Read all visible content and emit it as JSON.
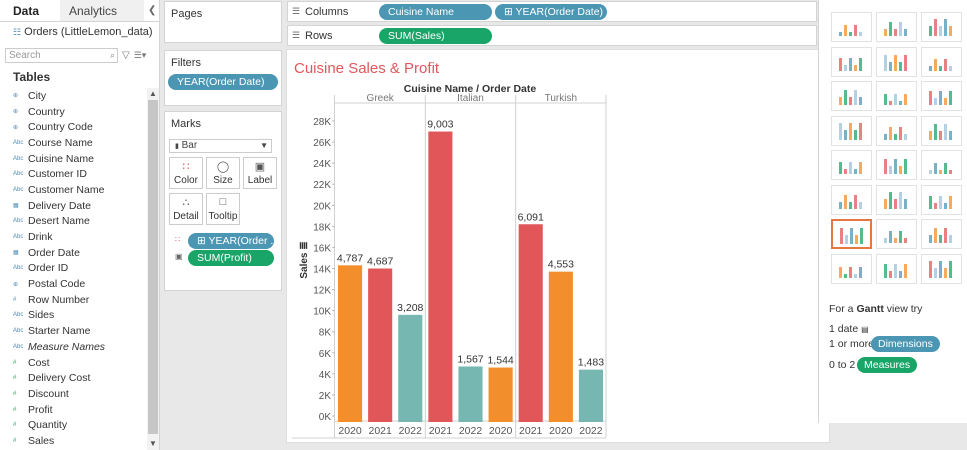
{
  "data_pane": {
    "tabs": [
      "Data",
      "Analytics"
    ],
    "datasource": "Orders (LittleLemon_data)",
    "search_placeholder": "Search",
    "tables_heading": "Tables",
    "fields": [
      {
        "name": "City",
        "kind": "geo"
      },
      {
        "name": "Country",
        "kind": "geo"
      },
      {
        "name": "Country Code",
        "kind": "geo"
      },
      {
        "name": "Course Name",
        "kind": "text"
      },
      {
        "name": "Cuisine Name",
        "kind": "text"
      },
      {
        "name": "Customer ID",
        "kind": "text"
      },
      {
        "name": "Customer Name",
        "kind": "text"
      },
      {
        "name": "Delivery Date",
        "kind": "date"
      },
      {
        "name": "Desert Name",
        "kind": "text"
      },
      {
        "name": "Drink",
        "kind": "text"
      },
      {
        "name": "Order Date",
        "kind": "date"
      },
      {
        "name": "Order ID",
        "kind": "text"
      },
      {
        "name": "Postal Code",
        "kind": "geo"
      },
      {
        "name": "Row Number",
        "kind": "number"
      },
      {
        "name": "Sides",
        "kind": "text"
      },
      {
        "name": "Starter Name",
        "kind": "text"
      },
      {
        "name": "Measure Names",
        "kind": "text",
        "italic": true
      },
      {
        "name": "Cost",
        "kind": "measure"
      },
      {
        "name": "Delivery Cost",
        "kind": "measure"
      },
      {
        "name": "Discount",
        "kind": "measure"
      },
      {
        "name": "Profit",
        "kind": "measure"
      },
      {
        "name": "Quantity",
        "kind": "measure"
      },
      {
        "name": "Sales",
        "kind": "measure"
      }
    ]
  },
  "pages": {
    "title": "Pages"
  },
  "filters": {
    "title": "Filters",
    "pill": "YEAR(Order Date)"
  },
  "marks": {
    "title": "Marks",
    "type": "Bar",
    "buttons": [
      "Color",
      "Size",
      "Label",
      "Detail",
      "Tooltip"
    ],
    "pills": [
      "YEAR(Order ..",
      "SUM(Profit)"
    ]
  },
  "columns": {
    "label": "Columns",
    "pills": [
      "Cuisine Name",
      "YEAR(Order Date)"
    ]
  },
  "rows": {
    "label": "Rows",
    "pills": [
      "SUM(Sales)"
    ]
  },
  "showme": {
    "hint_prefix": "For a ",
    "hint_bold": "Gantt",
    "hint_suffix": " view try",
    "req1": "1 date",
    "req2": "1 or more",
    "req2_pill": "Dimensions",
    "req3": "0 to 2",
    "req3_pill": "Measures",
    "colors": {
      "dimension": "#4b96b3",
      "measure": "#19a468",
      "selected": "#e57743"
    }
  },
  "colors": {
    "year_2020": "#f28e2b",
    "year_2021": "#e15759",
    "year_2022": "#76b7b2",
    "title": "#e0575c"
  },
  "chart_data": {
    "type": "bar",
    "title": "Cuisine Sales & Profit",
    "header": "Cuisine Name / Order Date",
    "groups": [
      {
        "name": "Greek",
        "bars": [
          {
            "year": "2020",
            "sales": 14300,
            "label": "4,787"
          },
          {
            "year": "2021",
            "sales": 14000,
            "label": "4,687"
          },
          {
            "year": "2022",
            "sales": 9600,
            "label": "3,208"
          }
        ]
      },
      {
        "name": "Italian",
        "bars": [
          {
            "year": "2021",
            "sales": 27000,
            "label": "9,003"
          },
          {
            "year": "2022",
            "sales": 4700,
            "label": "1,567"
          },
          {
            "year": "2020",
            "sales": 4600,
            "label": "1,544"
          }
        ]
      },
      {
        "name": "Turkish",
        "bars": [
          {
            "year": "2021",
            "sales": 18200,
            "label": "6,091"
          },
          {
            "year": "2020",
            "sales": 13700,
            "label": "4,553"
          },
          {
            "year": "2022",
            "sales": 4400,
            "label": "1,483"
          }
        ]
      }
    ],
    "ylabel": "Sales",
    "yticks": [
      "0K",
      "2K",
      "4K",
      "6K",
      "8K",
      "10K",
      "12K",
      "14K",
      "16K",
      "18K",
      "20K",
      "22K",
      "24K",
      "26K",
      "28K"
    ],
    "ylim": [
      0,
      28000
    ],
    "color_by": "YEAR(Order Date)",
    "label_by": "SUM(Profit)"
  }
}
